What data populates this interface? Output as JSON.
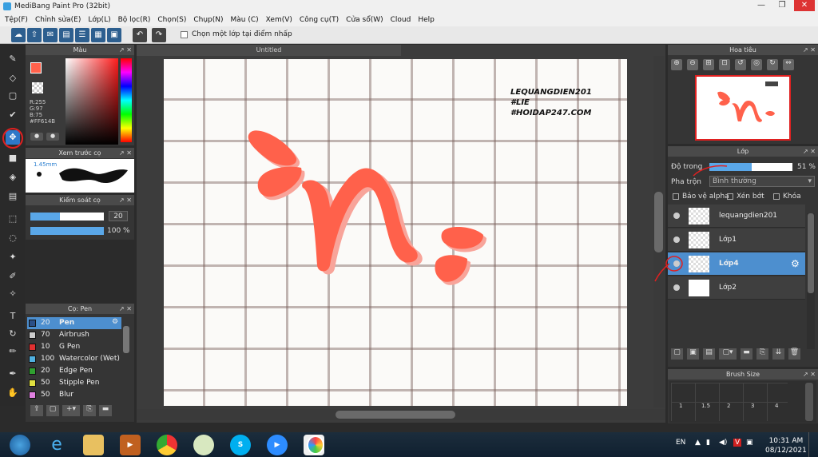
{
  "window": {
    "title": "MediBang Paint Pro (32bit)",
    "min": "—",
    "max": "❐",
    "close": "✕"
  },
  "menu": [
    "Tệp(F)",
    "Chỉnh sửa(E)",
    "Lớp(L)",
    "Bộ lọc(R)",
    "Chọn(S)",
    "Chụp(N)",
    "Màu (C)",
    "Xem(V)",
    "Công cụ(T)",
    "Cửa sổ(W)",
    "Cloud",
    "Help"
  ],
  "toolbar": {
    "checkbox_label": "Chọn một lớp tại điểm nhấp"
  },
  "color_panel": {
    "title": "Màu",
    "r": "R:255",
    "g": "G:97",
    "b": "B:75",
    "hex": "#FF614B",
    "primary_color": "#FF614B"
  },
  "preview_panel": {
    "title": "Xem trước cọ",
    "size": "1.45mm"
  },
  "control_panel": {
    "title": "Kiểm soát cọ",
    "size_value": "20",
    "opacity_value": "100 %"
  },
  "brush_panel": {
    "title": "Cọ: Pen",
    "items": [
      {
        "size": "20",
        "name": "Pen",
        "color": "#2a4f88"
      },
      {
        "size": "70",
        "name": "Airbrush",
        "color": "#cccccc"
      },
      {
        "size": "10",
        "name": "G Pen",
        "color": "#e03030"
      },
      {
        "size": "100",
        "name": "Watercolor (Wet)",
        "color": "#50b0e0"
      },
      {
        "size": "20",
        "name": "Edge Pen",
        "color": "#30a030"
      },
      {
        "size": "50",
        "name": "Stipple Pen",
        "color": "#e0e040"
      },
      {
        "size": "50",
        "name": "Blur",
        "color": "#e080e0"
      }
    ]
  },
  "canvas": {
    "tab_title": "Untitled",
    "watermark_line1": "LEQUANGDIEN201",
    "watermark_line2": "#LIE",
    "watermark_line3": "#HOIDAP247.COM",
    "stroke_color": "#FF614B"
  },
  "navigator_panel": {
    "title": "Hoa tiêu"
  },
  "layer_panel": {
    "title": "Lớp",
    "opacity_label": "Độ trong",
    "opacity_value": "51 %",
    "opacity_fraction": 0.51,
    "blend_label": "Pha trộn",
    "blend_value": "Bình thường",
    "protect_alpha": "Bảo vệ alpha",
    "clipping": "Xén bớt",
    "lock": "Khóa",
    "layers": [
      {
        "name": "lequangdien201",
        "selected": false
      },
      {
        "name": "Lớp1",
        "selected": false
      },
      {
        "name": "Lớp4",
        "selected": true
      },
      {
        "name": "Lớp2",
        "selected": false
      }
    ]
  },
  "brush_size_panel": {
    "title": "Brush Size",
    "labels": [
      "1",
      "1.5",
      "2",
      "3",
      "4"
    ]
  },
  "taskbar": {
    "lang": "EN",
    "time": "10:31 AM",
    "date": "08/12/2021"
  }
}
